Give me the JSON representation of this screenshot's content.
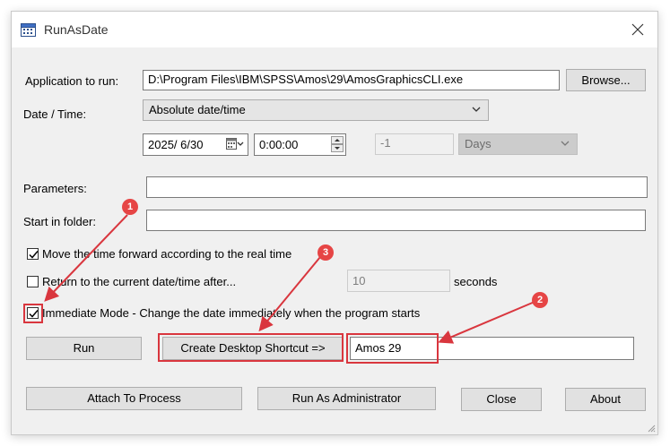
{
  "window": {
    "title": "RunAsDate"
  },
  "form": {
    "app_label": "Application to run:",
    "app_value": "D:\\Program Files\\IBM\\SPSS\\Amos\\29\\AmosGraphicsCLI.exe",
    "browse_label": "Browse...",
    "datetime_label": "Date / Time:",
    "mode_selected": "Absolute date/time",
    "date_value": "2025/  6/30",
    "time_value": "0:00:00",
    "offset_value": "-1",
    "offset_unit": "Days",
    "params_label": "Parameters:",
    "params_value": "",
    "startin_label": "Start in folder:",
    "startin_value": ""
  },
  "options": {
    "move_time_label": "Move the time forward according to the real time",
    "move_time_checked": true,
    "return_label": "Return to the current date/time after...",
    "return_checked": false,
    "return_seconds_value": "10",
    "seconds_label": "seconds",
    "immediate_label": "Immediate Mode - Change the date immediately when the program starts",
    "immediate_checked": true
  },
  "buttons": {
    "run": "Run",
    "shortcut": "Create Desktop Shortcut =>",
    "shortcut_name_value": "Amos 29",
    "attach": "Attach To Process",
    "run_admin": "Run As Administrator",
    "close": "Close",
    "about": "About"
  },
  "annotations": {
    "badges": [
      "1",
      "2",
      "3"
    ],
    "color": "#d9363e"
  }
}
